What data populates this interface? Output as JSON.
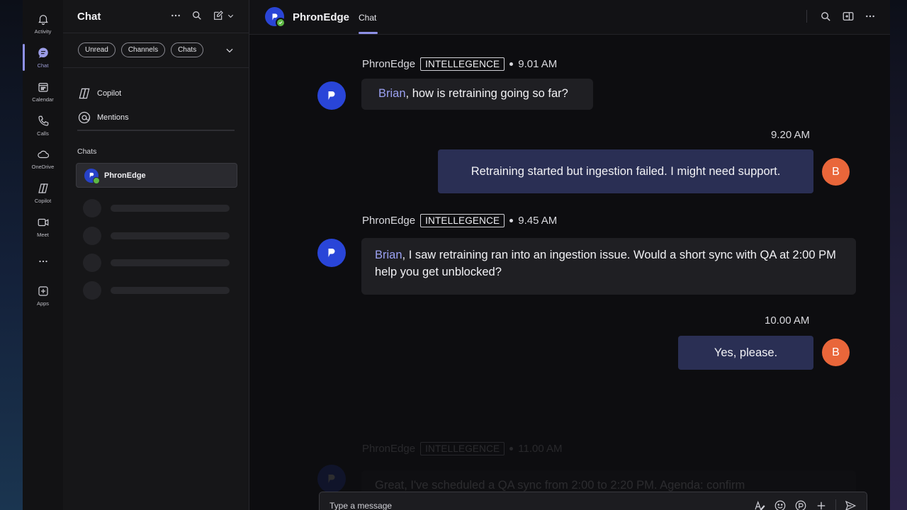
{
  "rail": {
    "items": [
      {
        "label": "Activity"
      },
      {
        "label": "Chat"
      },
      {
        "label": "Calendar"
      },
      {
        "label": "Calls"
      },
      {
        "label": "OneDrive"
      },
      {
        "label": "Copilot"
      },
      {
        "label": "Meet"
      },
      {
        "label": "Apps"
      }
    ],
    "active": "Chat"
  },
  "chat_list": {
    "title": "Chat",
    "filters": [
      "Unread",
      "Channels",
      "Chats"
    ],
    "nav": [
      {
        "label": "Copilot",
        "icon": "copilot-icon"
      },
      {
        "label": "Mentions",
        "icon": "at-sign-icon"
      }
    ],
    "section_label": "Chats",
    "active_chat": {
      "name": "PhronEdge",
      "presence": "available"
    }
  },
  "header": {
    "name": "PhronEdge",
    "tab": "Chat"
  },
  "messages": [
    {
      "sender": "PhronEdge",
      "tag": "INTELLEGENCE",
      "time": "9.01 AM",
      "mention": "Brian",
      "text": ", how is retraining going so far?"
    },
    {
      "time": "9.20 AM",
      "text": "Retraining started but ingestion failed. I might need support.",
      "avatar": "B"
    },
    {
      "sender": "PhronEdge",
      "tag": "INTELLEGENCE",
      "time": "9.45 AM",
      "mention": "Brian",
      "text": ", I saw retraining ran into an ingestion issue. Would a short sync with QA at 2:00 PM help you get unblocked?"
    },
    {
      "time": "10.00 AM",
      "text": "Yes, please.",
      "avatar": "B"
    },
    {
      "sender": "PhronEdge",
      "tag": "INTELLEGENCE",
      "time": "11.00 AM",
      "text": "Great, I've scheduled a QA sync from 2:00 to 2:20 PM. Agenda: confirm"
    }
  ],
  "composer": {
    "placeholder": "Type a message"
  },
  "colors": {
    "accent": "#8e90e6",
    "bot_avatar": "#2945d8",
    "user_avatar": "#e9663a",
    "outgoing_bubble": "#2a2f54",
    "incoming_bubble": "#1f1f23"
  }
}
